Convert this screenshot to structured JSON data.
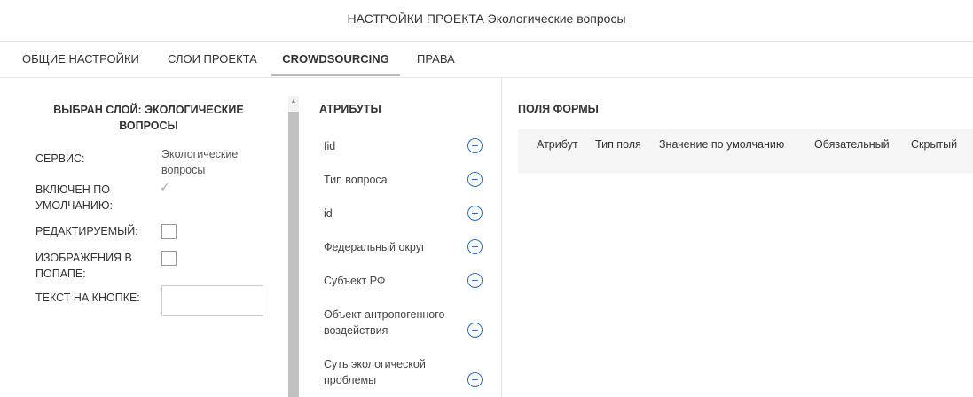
{
  "header": {
    "title": "НАСТРОЙКИ ПРОЕКТА Экологические вопросы"
  },
  "tabs": [
    {
      "label": "ОБЩИЕ НАСТРОЙКИ"
    },
    {
      "label": "СЛОИ ПРОЕКТА"
    },
    {
      "label": "CROWDSOURCING"
    },
    {
      "label": "ПРАВА"
    }
  ],
  "left": {
    "layer_title": "ВЫБРАН СЛОЙ: ЭКОЛОГИЧЕСКИЕ ВОПРОСЫ",
    "service_label": "СЕРВИС:",
    "service_value": "Экологические вопросы",
    "default_label": "ВКЛЮЧЕН ПО УМОЛЧАНИЮ:",
    "editable_label": "РЕДАКТИРУЕМЫЙ:",
    "images_label": "ИЗОБРАЖЕНИЯ В ПОПАПЕ:",
    "button_text_label": "ТЕКСТ НА КНОПКЕ:",
    "button_text_value": ""
  },
  "attributes": {
    "title": "АТРИБУТЫ",
    "items": [
      "fid",
      "Тип вопроса",
      "id",
      "Федеральный округ",
      "Субъект РФ",
      "Объект антропогенного воздействия",
      "Суть экологической проблемы"
    ]
  },
  "form": {
    "title": "ПОЛЯ ФОРМЫ",
    "columns": [
      "Атрибут",
      "Тип поля",
      "Значение по умолчанию",
      "Обязательный",
      "Скрытый"
    ]
  }
}
